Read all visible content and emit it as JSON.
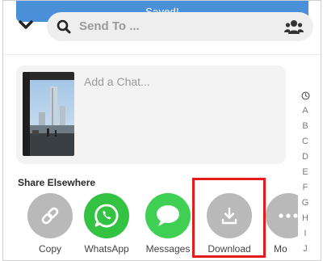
{
  "banner": {
    "text": "Saved!"
  },
  "search": {
    "placeholder": "Send To ..."
  },
  "chat": {
    "placeholder": "Add a Chat..."
  },
  "alphabet": [
    "A",
    "B",
    "C",
    "D",
    "E",
    "F",
    "G",
    "H",
    "I",
    "J"
  ],
  "share": {
    "title": "Share Elsewhere",
    "items": [
      {
        "label": "Copy",
        "icon": "link-icon",
        "color": "#b9b9b9"
      },
      {
        "label": "WhatsApp",
        "icon": "whatsapp-icon",
        "color": "#34c243"
      },
      {
        "label": "Messages",
        "icon": "messages-icon",
        "color": "#3fcf53"
      },
      {
        "label": "Download",
        "icon": "download-icon",
        "color": "#b9b9b9"
      },
      {
        "label": "Mo",
        "icon": "more-icon",
        "color": "#b9b9b9"
      }
    ]
  },
  "colors": {
    "accent": "#4a90d9",
    "highlight": "#e31b1b"
  }
}
